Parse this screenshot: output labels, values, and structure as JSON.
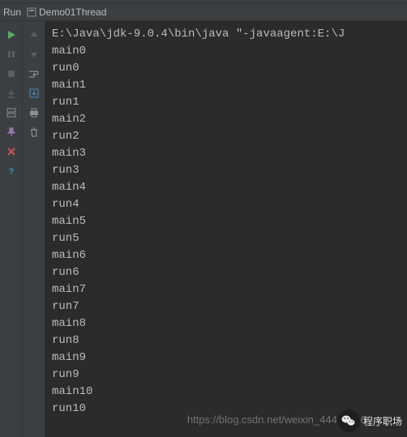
{
  "header": {
    "run_label": "Run",
    "thread_name": "Demo01Thread"
  },
  "console": {
    "command": "E:\\Java\\jdk-9.0.4\\bin\\java \"-javaagent:E:\\J",
    "lines": [
      "main0",
      "run0",
      "main1",
      "run1",
      "main2",
      "run2",
      "main3",
      "run3",
      "main4",
      "run4",
      "main5",
      "run5",
      "main6",
      "run6",
      "main7",
      "run7",
      "main8",
      "run8",
      "main9",
      "run9",
      "main10",
      "run10"
    ]
  },
  "watermark": "https://blog.csdn.net/weixin_44406146",
  "wechat_label": "程序职场",
  "icons": {
    "run": "run-icon",
    "stop": "stop-icon",
    "pause": "pause-icon",
    "down": "down-arrow-icon",
    "up": "up-arrow-icon",
    "wrap": "wrap-icon",
    "scroll": "scroll-icon",
    "print": "print-icon",
    "clear": "trash-icon",
    "export": "export-icon",
    "pin": "pin-icon",
    "close": "close-icon",
    "help": "help-icon",
    "layout": "layout-icon",
    "settings": "settings-icon"
  },
  "colors": {
    "run_green": "#59a869",
    "close_red": "#c75450",
    "help_blue": "#3592c4",
    "pin_purple": "#9876aa",
    "icon_grey": "#8a8f93",
    "scroll_blue": "#4a88c7"
  }
}
